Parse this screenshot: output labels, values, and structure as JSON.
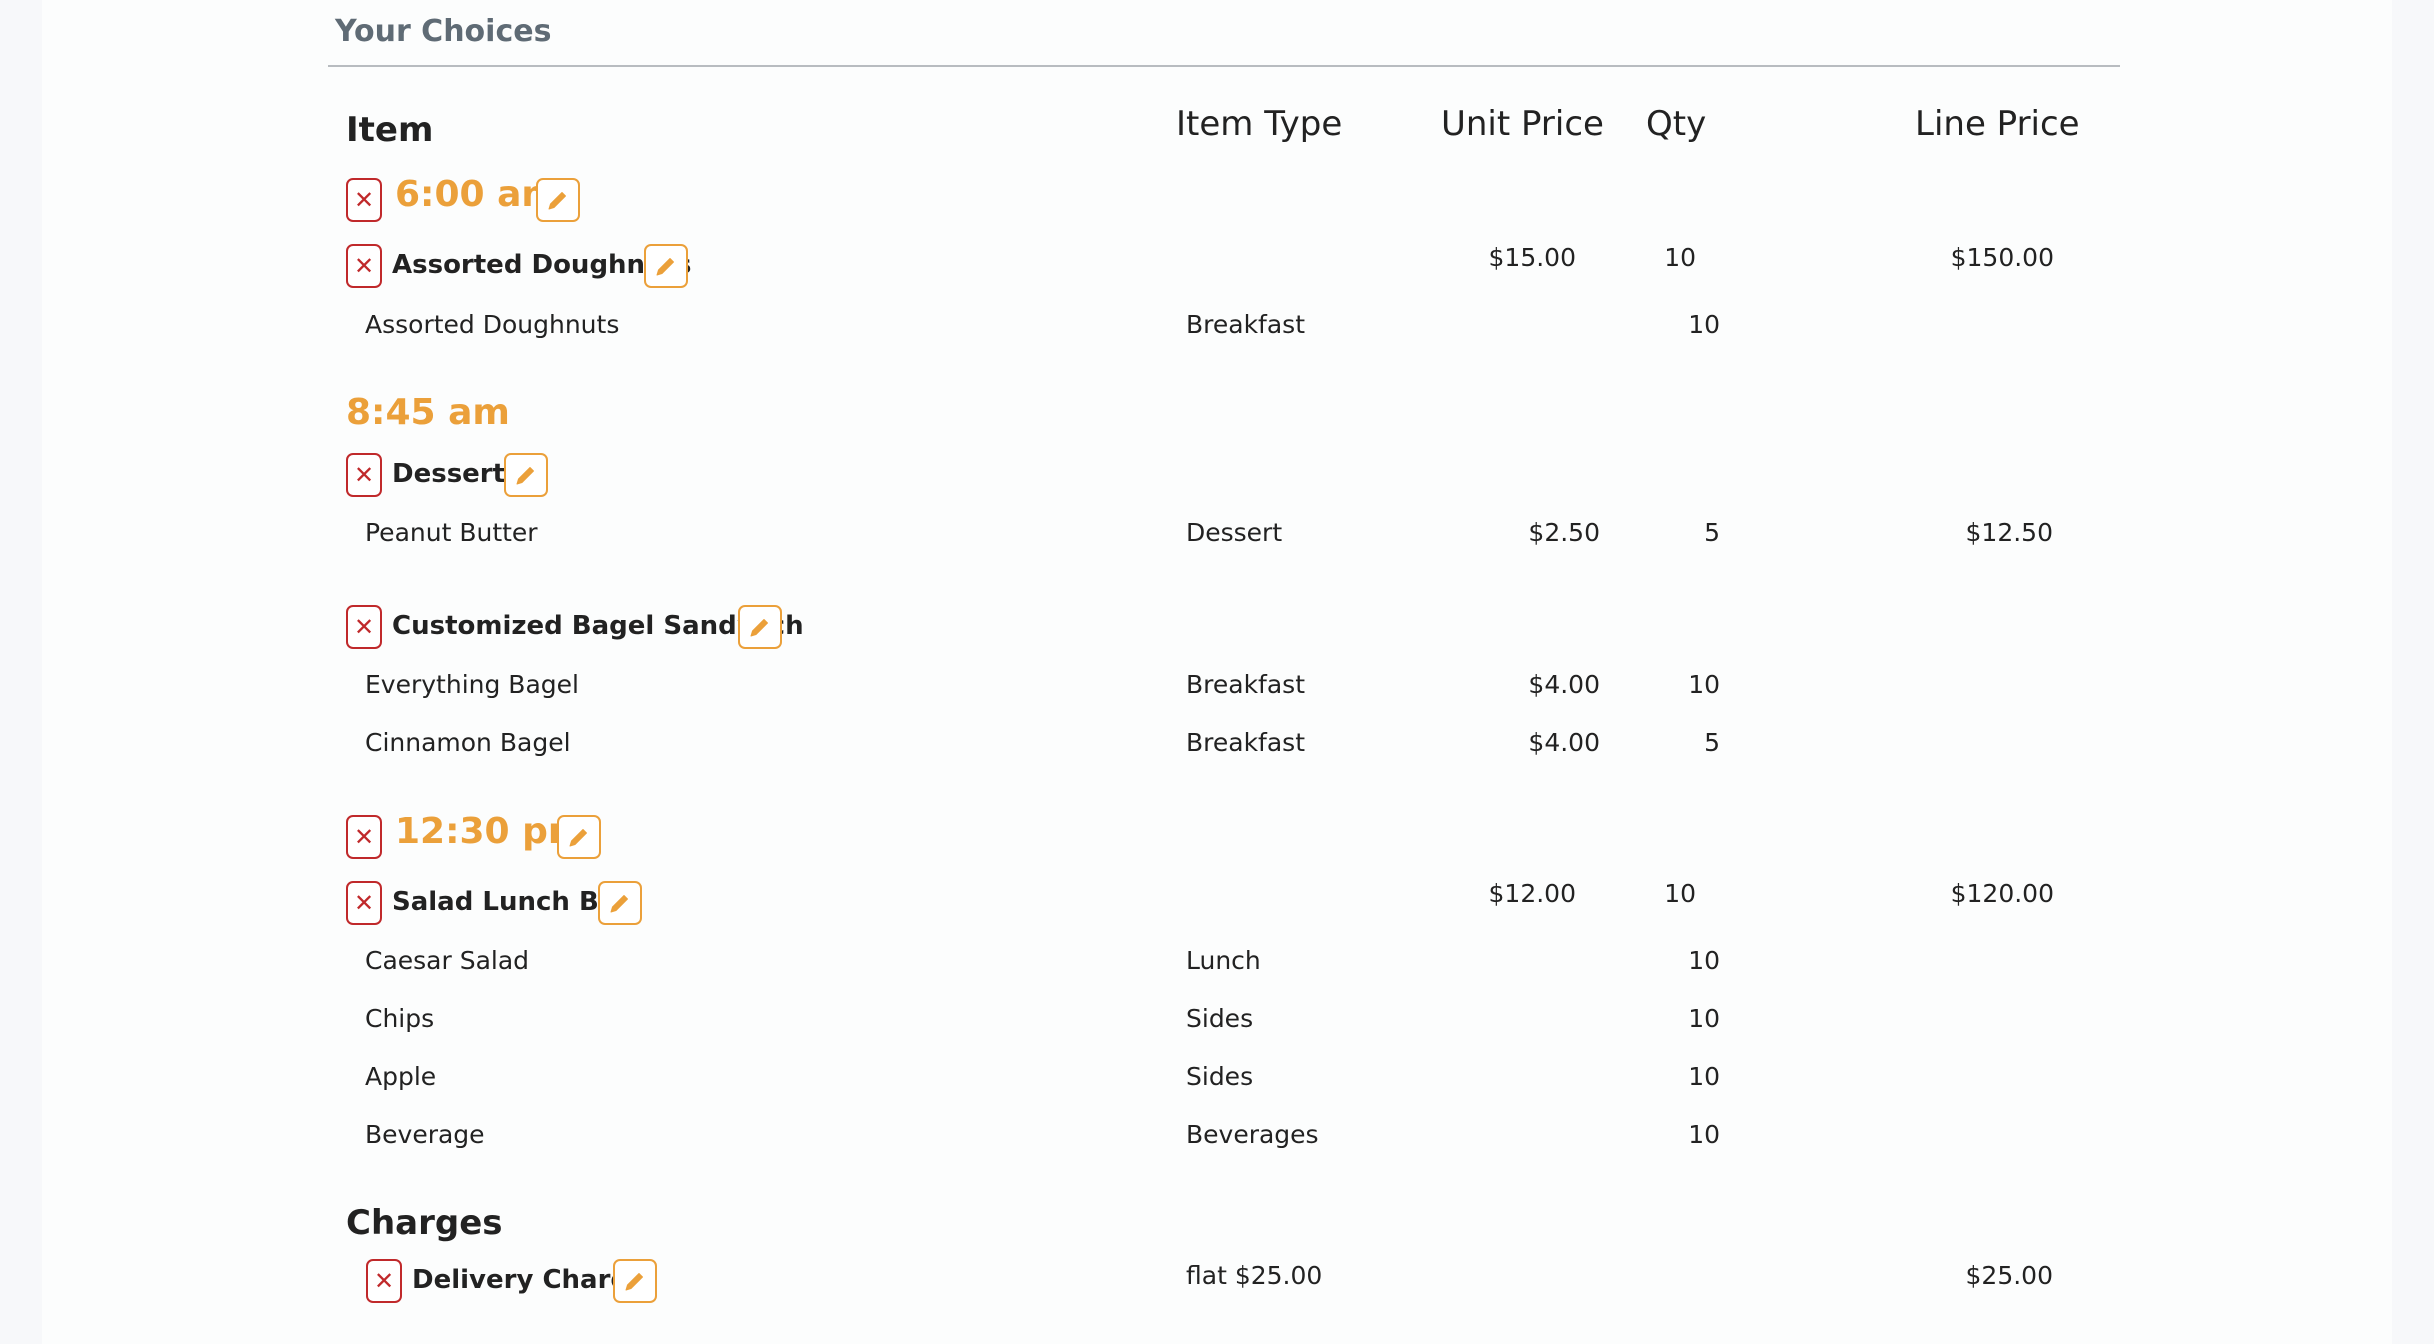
{
  "section": {
    "title": "Your Choices"
  },
  "columns": {
    "item": "Item",
    "item_type": "Item Type",
    "unit_price": "Unit Price",
    "qty": "Qty",
    "line_price": "Line Price"
  },
  "icons": {
    "remove": "close-icon",
    "edit": "pencil-icon"
  },
  "colors": {
    "time_accent": "#eba03a",
    "remove_red": "#c0292b",
    "edit_border": "#eba03a"
  },
  "groups": [
    {
      "time": "6:00 am",
      "packages": [
        {
          "name": "Assorted Doughnuts",
          "unit_price": "$15.00",
          "qty": "10",
          "line_price": "$150.00",
          "items": [
            {
              "name": "Assorted Doughnuts",
              "type": "Breakfast",
              "unit_price": "",
              "qty": "10",
              "line_price": ""
            }
          ]
        }
      ]
    },
    {
      "time": "8:45 am",
      "packages": [
        {
          "name": "Desserts",
          "unit_price": "",
          "qty": "",
          "line_price": "",
          "items": [
            {
              "name": "Peanut Butter",
              "type": "Dessert",
              "unit_price": "$2.50",
              "qty": "5",
              "line_price": "$12.50"
            }
          ]
        },
        {
          "name": "Customized Bagel Sandwich",
          "unit_price": "",
          "qty": "",
          "line_price": "",
          "items": [
            {
              "name": "Everything Bagel",
              "type": "Breakfast",
              "unit_price": "$4.00",
              "qty": "10",
              "line_price": ""
            },
            {
              "name": "Cinnamon Bagel",
              "type": "Breakfast",
              "unit_price": "$4.00",
              "qty": "5",
              "line_price": ""
            }
          ]
        }
      ]
    },
    {
      "time": "12:30 pm",
      "packages": [
        {
          "name": "Salad Lunch Box",
          "unit_price": "$12.00",
          "qty": "10",
          "line_price": "$120.00",
          "items": [
            {
              "name": "Caesar Salad",
              "type": "Lunch",
              "unit_price": "",
              "qty": "10",
              "line_price": ""
            },
            {
              "name": "Chips",
              "type": "Sides",
              "unit_price": "",
              "qty": "10",
              "line_price": ""
            },
            {
              "name": "Apple",
              "type": "Sides",
              "unit_price": "",
              "qty": "10",
              "line_price": ""
            },
            {
              "name": "Beverage",
              "type": "Beverages",
              "unit_price": "",
              "qty": "10",
              "line_price": ""
            }
          ]
        }
      ]
    }
  ],
  "charges": {
    "title": "Charges",
    "items": [
      {
        "name": "Delivery Charge",
        "rate": "flat $25.00",
        "line_price": "$25.00"
      }
    ]
  }
}
